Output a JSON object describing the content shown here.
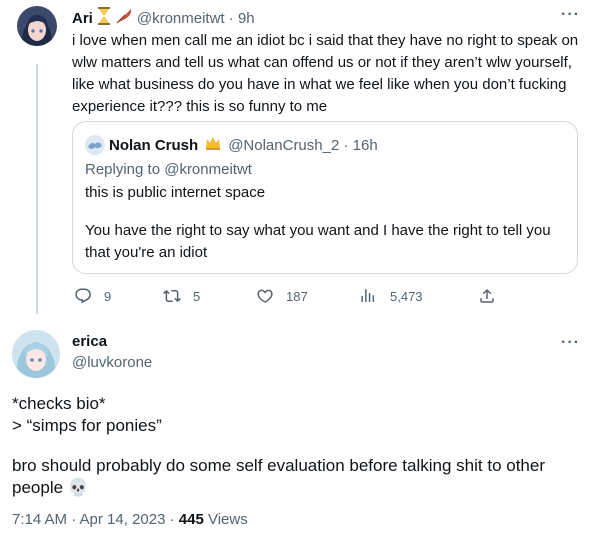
{
  "tweet": {
    "name": "Ari",
    "handle": "@kronmeitwt",
    "sep": " · ",
    "time": "9h",
    "text": "i love when men call me an idiot bc i said that they have no right to speak on wlw matters and tell us what can offend us or not if they aren’t wlw yourself, like what business do you have in what we feel like when you don’t fucking experience it??? this is so funny to me",
    "quote": {
      "name": "Nolan Crush",
      "handle": "@NolanCrush_2",
      "sep": " · ",
      "time": "16h",
      "replying_to": "Replying to @kronmeitwt",
      "line1": "this is public internet space",
      "line2": "You have the right to say what you want and I have the right to tell you that you're an idiot"
    },
    "actions": {
      "replies": "9",
      "retweets": "5",
      "likes": "187",
      "views": "5,473"
    }
  },
  "reply": {
    "name": "erica",
    "handle": "@luvkorone",
    "line1": "*checks bio*",
    "line2": "> “simps for ponies”",
    "line3": "bro should probably do some self evaluation before talking shit to other people 💀",
    "time": "7:14 AM · Apr 14, 2023 · ",
    "views_count": "445",
    "views_label": " Views"
  },
  "icons": [
    "more-icon",
    "reply-icon",
    "retweet-icon",
    "like-icon",
    "views-icon",
    "share-icon",
    "hourglass-icon",
    "feather-icon",
    "crown-icon",
    "skull-icon"
  ],
  "colors": {
    "text": "#0f1419",
    "muted": "#536471",
    "border": "#cfd9de"
  }
}
